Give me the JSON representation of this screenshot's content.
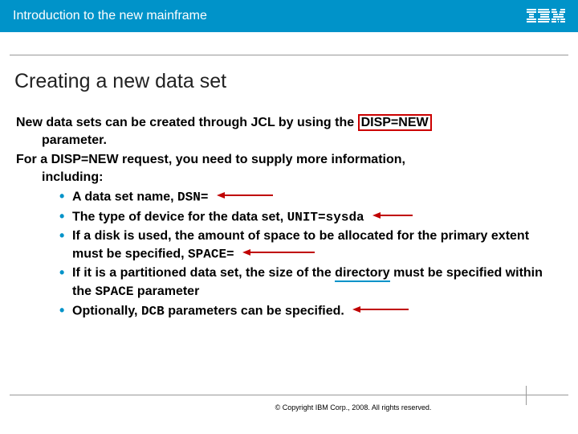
{
  "header": {
    "title": "Introduction to the new mainframe",
    "logo_name": "ibm-logo"
  },
  "title": "Creating a new data set",
  "p1_a": "New data sets can be created through JCL by using the ",
  "p1_box": "DISP=NEW",
  "p1_indent": "parameter.",
  "p2_a": "For a DISP=NEW request, you need to supply more information,",
  "p2_indent": "including:",
  "bullets": {
    "b1_a": "A data set name, ",
    "b1_code": "DSN=",
    "b2_a": "The type of device for the data set, ",
    "b2_code": "UNIT=sysda",
    "b3_a": "If a disk is used, the amount of space to be allocated for the primary extent must be specified, ",
    "b3_code": "SPACE=",
    "b4_a": "If it is a partitioned data set, the size of the ",
    "b4_ul": "directory",
    "b4_b": " must be specified within the ",
    "b4_code": "SPACE",
    "b4_c": " parameter",
    "b5_a": "Optionally, ",
    "b5_code": "DCB",
    "b5_b": " parameters can be specified."
  },
  "footer": {
    "copyright": "© Copyright IBM Corp., 2008. All rights reserved."
  },
  "colors": {
    "accent": "#0093c9",
    "arrow": "#c00000"
  }
}
